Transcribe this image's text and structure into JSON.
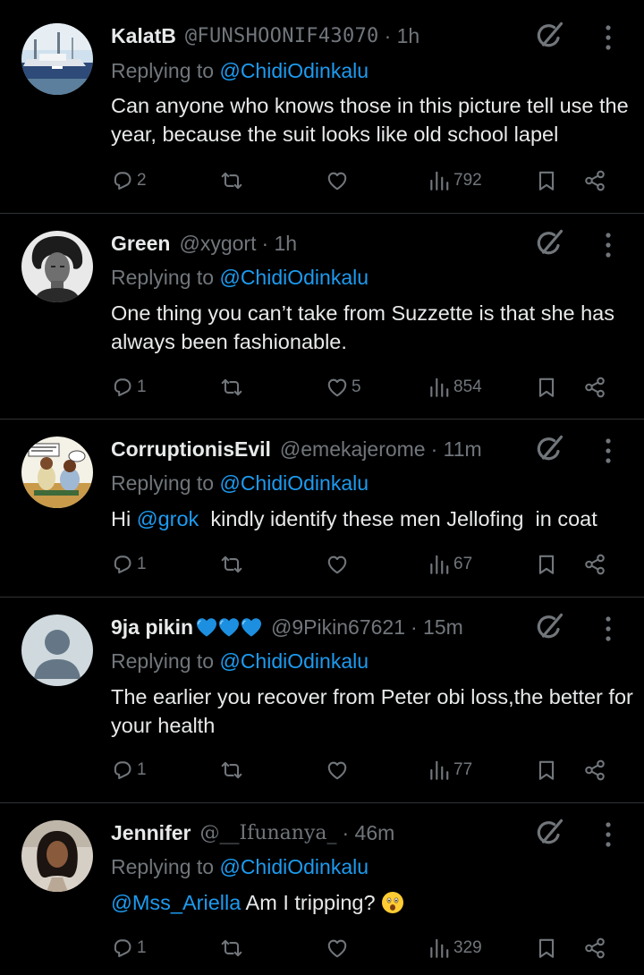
{
  "replies": [
    {
      "name": "KalatB",
      "handle": "@FUNSHOONIF43070",
      "time": "· 1h",
      "replying_prefix": "Replying to ",
      "replying_to": "@ChidiOdinkalu",
      "text": "Can anyone who knows those in this picture tell use the year, because the suit looks like old school lapel",
      "replies_count": "2",
      "reposts_count": "",
      "likes_count": "",
      "views_count": "792"
    },
    {
      "name": "Green",
      "handle": "@xygort",
      "time": "· 1h",
      "replying_prefix": "Replying to ",
      "replying_to": "@ChidiOdinkalu",
      "text": "One thing you can’t take from Suzzette is that she has always been fashionable.",
      "replies_count": "1",
      "reposts_count": "",
      "likes_count": "5",
      "views_count": "854"
    },
    {
      "name": "CorruptionisEvil",
      "handle": "@emekajerome",
      "time": "· 11m",
      "replying_prefix": "Replying to ",
      "replying_to": "@ChidiOdinkalu",
      "text_prefix": "Hi ",
      "text_mention": "@grok",
      "text_suffix": "  kindly identify these men Jellofing  in coat",
      "replies_count": "1",
      "reposts_count": "",
      "likes_count": "",
      "views_count": "67"
    },
    {
      "name": "9ja pikin",
      "name_emoji": "blue-heart-icon x3",
      "handle": "@9Pikin67621",
      "time": "· 15m",
      "replying_prefix": "Replying to ",
      "replying_to": "@ChidiOdinkalu",
      "text": "The earlier you recover from Peter obi loss,the better for your health",
      "replies_count": "1",
      "reposts_count": "",
      "likes_count": "",
      "views_count": "77"
    },
    {
      "name": "Jennifer",
      "handle": "@__Ifunanya_",
      "time": "· 46m",
      "replying_prefix": "Replying to ",
      "replying_to": "@ChidiOdinkalu",
      "text_mention": "@Mss_Ariella",
      "text_suffix": " Am I tripping?",
      "text_emoji": "astonished-face-icon",
      "replies_count": "1",
      "reposts_count": "",
      "likes_count": "",
      "views_count": "329"
    }
  ],
  "icons": {
    "reply": "reply-icon",
    "repost": "repost-icon",
    "like": "heart-icon",
    "views": "views-icon",
    "bookmark": "bookmark-icon",
    "share": "share-icon",
    "grok": "grok-icon",
    "more": "more-icon"
  },
  "colors": {
    "background": "#000000",
    "text": "#e7e9ea",
    "muted": "#71767b",
    "link": "#1d9bf0",
    "divider": "#2f3336",
    "heart_emoji": "#1d8fe0"
  }
}
